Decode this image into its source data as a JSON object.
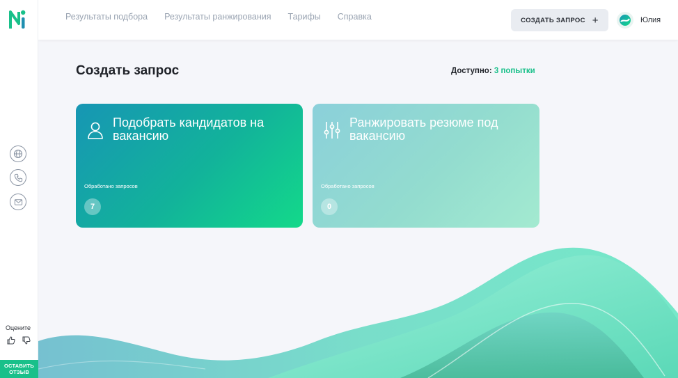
{
  "header": {
    "nav": [
      "Результаты подбора",
      "Результаты ранжирования",
      "Тарифы",
      "Справка"
    ],
    "create_button": "СОЗДАТЬ ЗАПРОС",
    "create_icon": "plus-icon",
    "user_name": "Юлия"
  },
  "sidebar": {
    "logo": "Ni",
    "icons": [
      "globe-icon",
      "phone-icon",
      "mail-icon"
    ],
    "rate_label": "Оцените",
    "feedback_line1": "ОСТАВИТЬ",
    "feedback_line2": "ОТЗЫВ"
  },
  "main": {
    "title": "Создать запрос",
    "available_label": "Доступно:",
    "available_value": "3 попытки",
    "cards": [
      {
        "title": "Подобрать кандидатов на вакансию",
        "sub": "Обработано запросов",
        "count": "7",
        "icon": "user-icon"
      },
      {
        "title": "Ранжировать резюме под вакансию",
        "sub": "Обработано запросов",
        "count": "0",
        "icon": "sliders-icon"
      }
    ]
  },
  "colors": {
    "accent": "#19c08a",
    "nav_text": "#9aa4b2"
  }
}
